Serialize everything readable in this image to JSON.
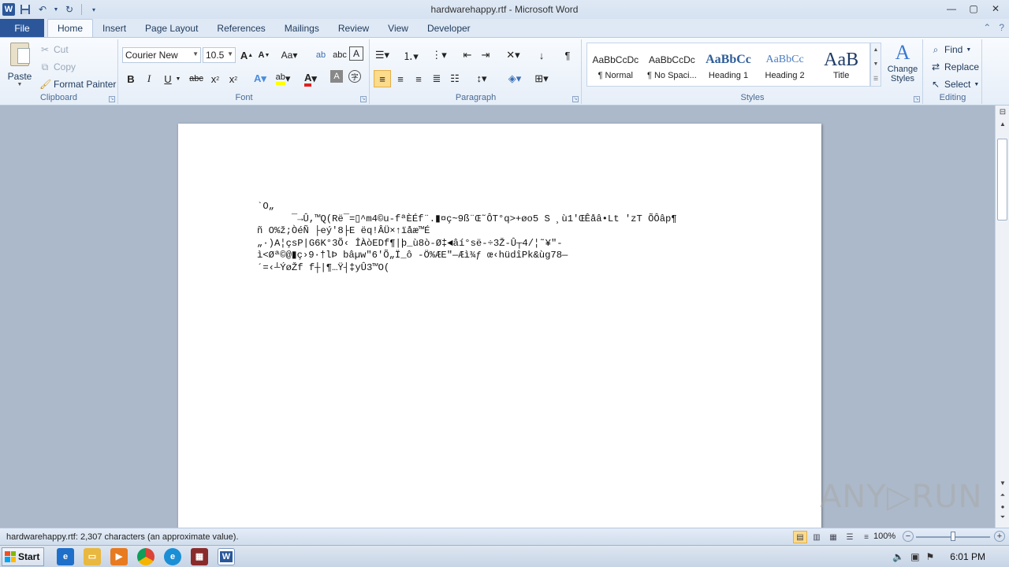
{
  "window": {
    "title": "hardwarehappy.rtf - Microsoft Word"
  },
  "qat": {
    "logo": "W"
  },
  "tabs": [
    "Insert",
    "Page Layout",
    "References",
    "Mailings",
    "Review",
    "View",
    "Developer"
  ],
  "file_tab": "File",
  "home_tab": "Home",
  "clipboard": {
    "paste": "Paste",
    "cut": "Cut",
    "copy": "Copy",
    "format_painter": "Format Painter",
    "label": "Clipboard"
  },
  "font": {
    "name": "Courier New",
    "size": "10.5",
    "label": "Font"
  },
  "paragraph": {
    "label": "Paragraph"
  },
  "styles": {
    "label": "Styles",
    "items": [
      {
        "sample": "AaBbCcDc",
        "name": "¶ Normal"
      },
      {
        "sample": "AaBbCcDc",
        "name": "¶ No Spaci..."
      },
      {
        "sample": "AaBbCc",
        "name": "Heading 1"
      },
      {
        "sample": "AaBbCc",
        "name": "Heading 2"
      },
      {
        "sample": "AaB",
        "name": "Title"
      }
    ],
    "change": "Change Styles"
  },
  "editing": {
    "label": "Editing",
    "find": "Find",
    "replace": "Replace",
    "select": "Select"
  },
  "document": {
    "lines": [
      "`O„",
      "      ¯→Û,™Q(Rë¯=▯^m4©u-fªÈÉf¨.▮¤ç~9ß¨Œ˜ÔT°q>+øo5 S ¸ù1'ŒÊåâ•Lt 'zT ÕÔâp¶",
      "ñ O%ž;ÒéÑ ├eý'8├E ëq!ÂÜ×↑ïåæ™É",
      "„·)A¦çsP|G6K°3Õ‹ ÎÀòEDf¶|þ_ù8ò-Ø‡◄âí°së-÷3Ž-Û┬4/¦˜¥\"-",
      "ì<Øª©@▮ç›9·†lÞ bâµw\"6'Õ„Ï_ô -Ö%ÆE\"—Æì¾ƒ œ‹hüdîPk&ùg78—",
      "´=‹┴ÝøŽf f┼|¶…Ÿ┤‡yÛ3™O("
    ]
  },
  "status": {
    "text": "hardwarehappy.rtf: 2,307 characters (an approximate value).",
    "zoom": "100%",
    "zoom_fraction": 0.5
  },
  "watermark": "ANY▷RUN",
  "taskbar": {
    "start": "Start",
    "clock": "6:01 PM"
  }
}
